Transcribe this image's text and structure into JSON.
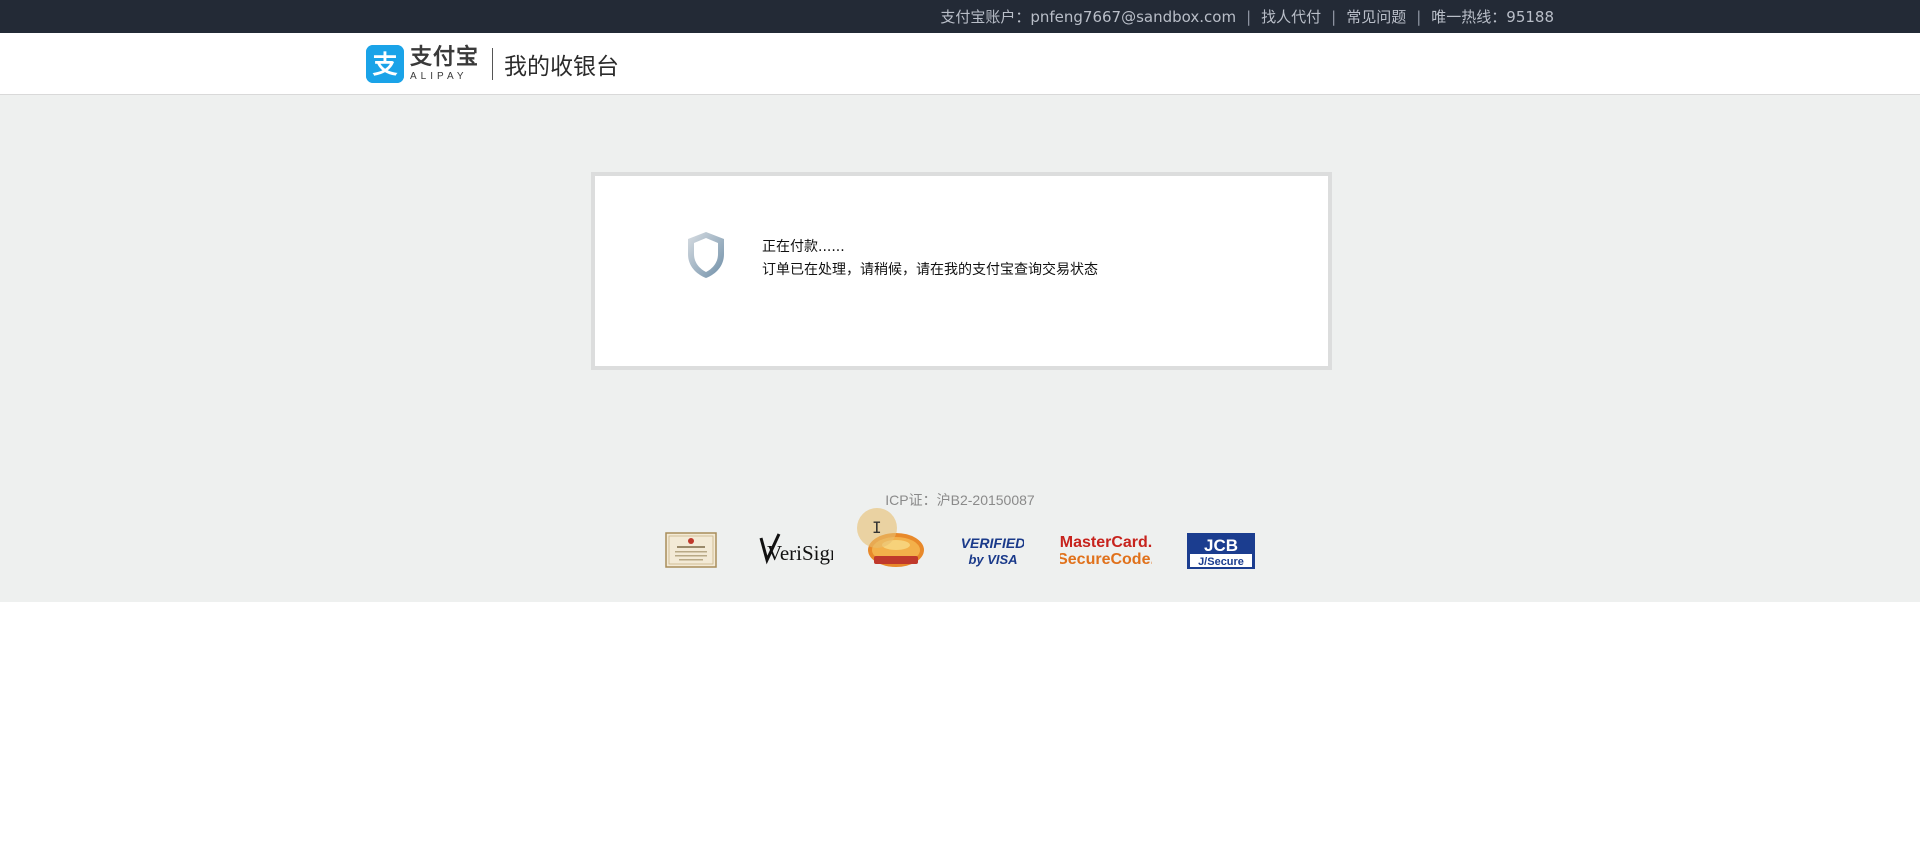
{
  "topbar": {
    "account_label": "支付宝账户：pnfeng7667@sandbox.com",
    "find_payer": "找人代付",
    "faq": "常见问题",
    "hotline": "唯一热线：95188",
    "separator": "|"
  },
  "header": {
    "logo_cn": "支付宝",
    "logo_en": "ALIPAY",
    "title": "我的收银台"
  },
  "status": {
    "title": "正在付款......",
    "detail": "订单已在处理，请稍候，请在我的支付宝查询交易状态"
  },
  "footer": {
    "icp": "ICP证：沪B2-20150087",
    "badges": [
      {
        "icon": "certificate-badge-icon"
      },
      {
        "icon": "verisign-logo-icon",
        "text": "VeriSign"
      },
      {
        "icon": "itruss-seal-icon"
      },
      {
        "icon": "verified-by-visa-icon",
        "text_top": "VERIFIED",
        "text_bottom": "by VISA"
      },
      {
        "icon": "mastercard-securecode-icon",
        "text_top": "MasterCard.",
        "text_bottom": "SecureCode."
      },
      {
        "icon": "jcb-jsecure-icon",
        "text_top": "JCB",
        "text_bottom": "J/Secure"
      }
    ]
  },
  "colors": {
    "topbar_bg": "#232a36",
    "content_bg": "#eef0ef",
    "alipay_blue": "#1aa3e8",
    "mastercard_orange": "#e0711b",
    "jcb_blue": "#1b3d8f"
  }
}
